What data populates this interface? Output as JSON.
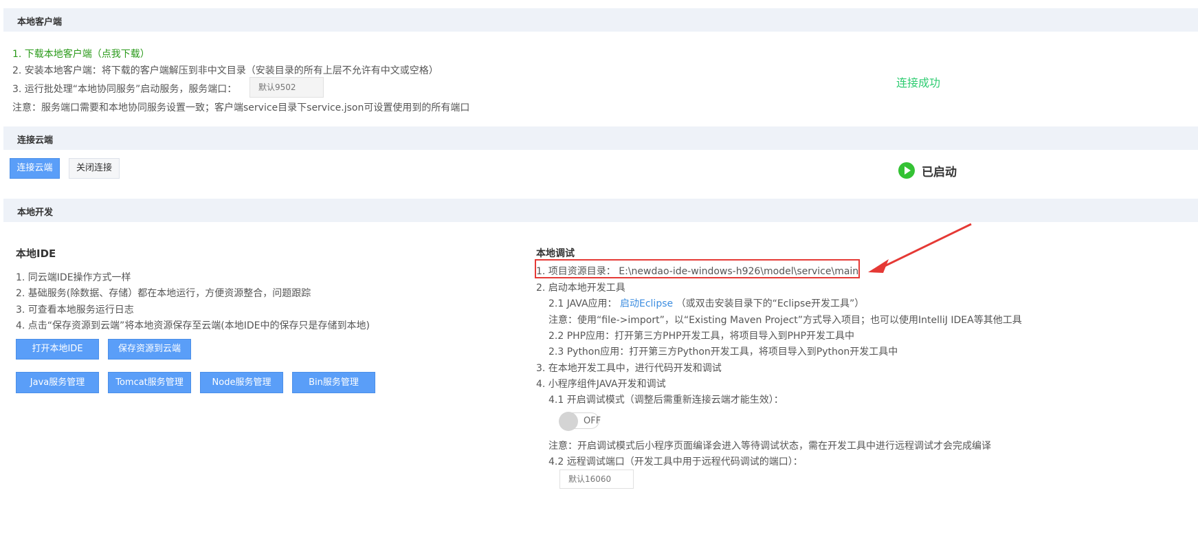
{
  "sections": {
    "local_client": "本地客户端",
    "connect_cloud": "连接云端",
    "local_dev": "本地开发"
  },
  "local_client": {
    "download_link": "1. 下载本地客户端（点我下载）",
    "step2": "2. 安装本地客户端：将下载的客户端解压到非中文目录（安装目录的所有上层不允许有中文或空格）",
    "step3_label": "3. 运行批处理“本地协同服务”启动服务，服务端口：",
    "port_placeholder": "默认9502",
    "note": "注意：服务端口需要和本地协同服务设置一致；客户端service目录下service.json可设置使用到的所有端口",
    "status": "连接成功"
  },
  "cloud": {
    "connect_button": "连接云端",
    "disconnect_button": "关闭连接",
    "status": "已启动",
    "status_color": "#34c234"
  },
  "local_ide": {
    "title": "本地IDE",
    "items": [
      "1. 同云端IDE操作方式一样",
      "2. 基础服务(除数据、存储）都在本地运行，方便资源整合，问题跟踪",
      "3. 可查看本地服务运行日志",
      "4. 点击“保存资源到云端”将本地资源保存至云端(本地IDE中的保存只是存储到本地)"
    ],
    "open_ide_button": "打开本地IDE",
    "save_cloud_button": "保存资源到云端",
    "service_buttons": [
      "Java服务管理",
      "Tomcat服务管理",
      "Node服务管理",
      "Bin服务管理"
    ]
  },
  "local_debug": {
    "title": "本地调试",
    "step1": "1. 项目资源目录： E:\\newdao-ide-windows-h926\\model\\service\\main",
    "step2": "2. 启动本地开发工具",
    "step2_1_prefix": "2.1 JAVA应用：",
    "step2_1_link": "启动Eclipse",
    "step2_1_suffix": "（或双击安装目录下的“Eclipse开发工具”）",
    "step2_1_note": "注意：使用“file->import”，以“Existing Maven Project”方式导入项目；也可以使用IntelliJ IDEA等其他工具",
    "step2_2": "2.2 PHP应用：打开第三方PHP开发工具，将项目导入到PHP开发工具中",
    "step2_3": "2.3 Python应用：打开第三方Python开发工具，将项目导入到Python开发工具中",
    "step3": "3. 在本地开发工具中，进行代码开发和调试",
    "step4": "4. 小程序组件JAVA开发和调试",
    "step4_1": "4.1 开启调试模式（调整后需重新连接云端才能生效）：",
    "toggle_label": "OFF",
    "toggle_on": false,
    "step4_1_note": "注意：开启调试模式后小程序页面编译会进入等待调试状态，需在开发工具中进行远程调试才会完成编译",
    "step4_2": "4.2 远程调试端口（开发工具中用于远程代码调试的端口）：",
    "debug_port_placeholder": "默认16060"
  },
  "annotation_color": "#e53935"
}
